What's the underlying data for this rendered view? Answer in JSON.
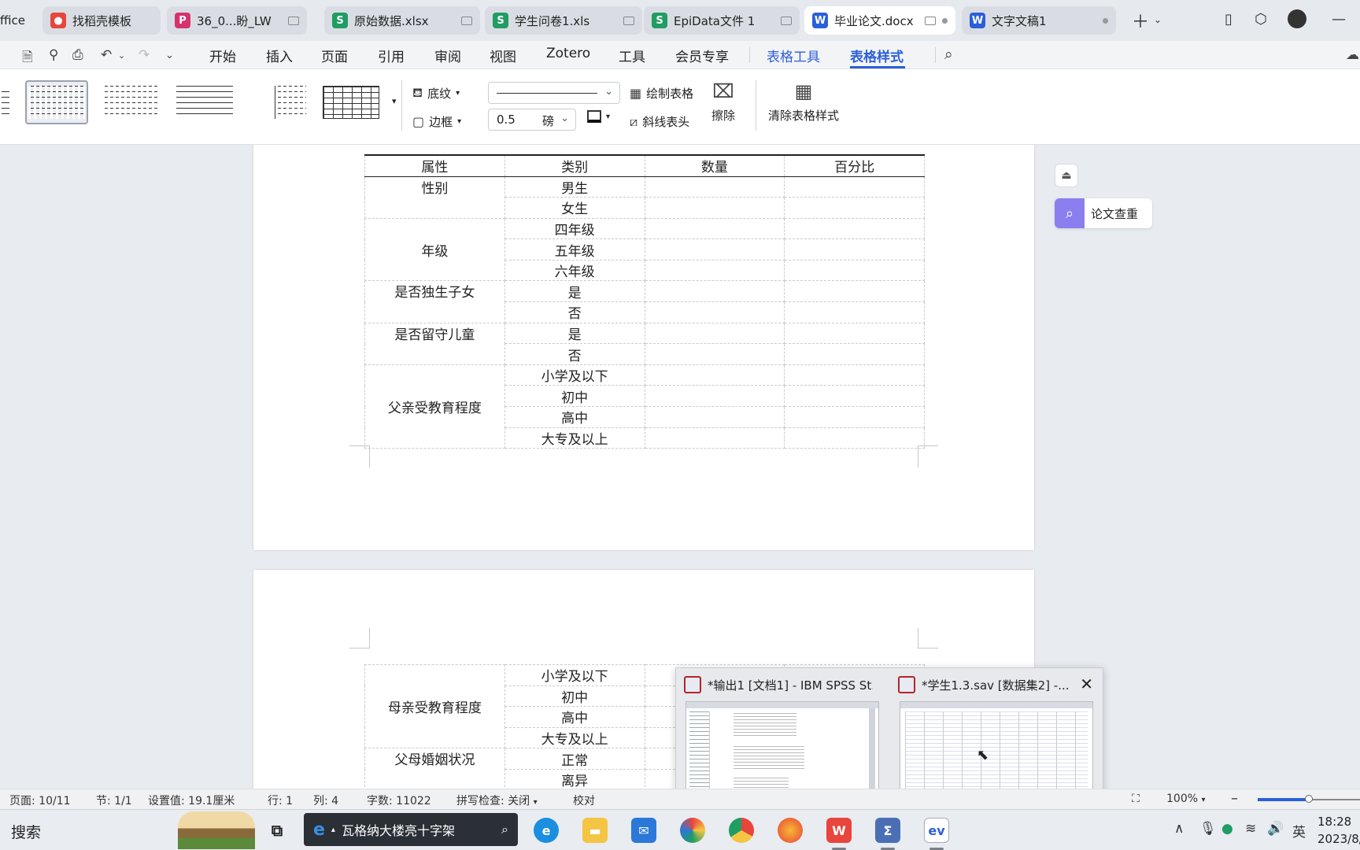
{
  "tabs": [
    {
      "label": "ffice",
      "icon": "office-tab",
      "color": "#e6e9ee"
    },
    {
      "label": "找稻壳模板",
      "icon": "docer-icon",
      "color": "#e8453c"
    },
    {
      "label": "36_0...盼_LW",
      "icon": "pdf-icon",
      "color": "#d6336c"
    },
    {
      "label": "原始数据.xlsx",
      "icon": "S",
      "color": "#1f9d63"
    },
    {
      "label": "学生问卷1.xls",
      "icon": "S",
      "color": "#1f9d63"
    },
    {
      "label": "EpiData文件 1",
      "icon": "S",
      "color": "#1f9d63"
    },
    {
      "label": "毕业论文.docx",
      "icon": "W",
      "color": "#2b5fd9"
    },
    {
      "label": "文字文稿1",
      "icon": "W",
      "color": "#2b5fd9"
    }
  ],
  "menu": {
    "items": [
      "开始",
      "插入",
      "页面",
      "引用",
      "审阅",
      "视图",
      "Zotero",
      "工具",
      "会员专享"
    ],
    "context": [
      "表格工具",
      "表格样式"
    ],
    "accent": "#2b5fd9"
  },
  "ribbon": {
    "shading": "底纹",
    "borders": "边框",
    "line_width_value": "0.5",
    "line_width_unit": "磅",
    "draw_table": "绘制表格",
    "diagonal_header": "斜线表头",
    "erase": "擦除",
    "clear_style": "清除表格样式"
  },
  "table1": {
    "headers": [
      "属性",
      "类别",
      "数量",
      "百分比"
    ],
    "groups": [
      {
        "attr": "性别",
        "cats": [
          "男生",
          "女生"
        ]
      },
      {
        "attr": "年级",
        "cats": [
          "四年级",
          "五年级",
          "六年级"
        ]
      },
      {
        "attr": "是否独生子女",
        "cats": [
          "是",
          "否"
        ]
      },
      {
        "attr": "是否留守儿童",
        "cats": [
          "是",
          "否"
        ]
      },
      {
        "attr": "父亲受教育程度",
        "cats": [
          "小学及以下",
          "初中",
          "高中",
          "大专及以上"
        ]
      }
    ]
  },
  "table2": {
    "groups": [
      {
        "attr": "母亲受教育程度",
        "cats": [
          "小学及以下",
          "初中",
          "高中",
          "大专及以上"
        ]
      },
      {
        "attr": "父母婚姻状况",
        "cats": [
          "正常",
          "离异"
        ]
      }
    ]
  },
  "side_widget": {
    "label": "论文查重"
  },
  "thumbnails": [
    {
      "title": "*输出1 [文档1] - IBM SPSS St..."
    },
    {
      "title": "*学生1.3.sav [数据集2] -..."
    }
  ],
  "status": {
    "page": "页面: 10/11",
    "section": "节: 1/1",
    "position": "设置值: 19.1厘米",
    "row": "行: 1",
    "col": "列: 4",
    "words": "字数: 11022",
    "spell": "拼写检查: 关闭",
    "proof": "校对",
    "zoom": "100%",
    "zoom_slider": 0.5
  },
  "taskbar": {
    "search": "搜索",
    "news": "瓦格纳大楼亮十字架",
    "ime": "英",
    "time": "18:28",
    "date": "2023/8/"
  }
}
